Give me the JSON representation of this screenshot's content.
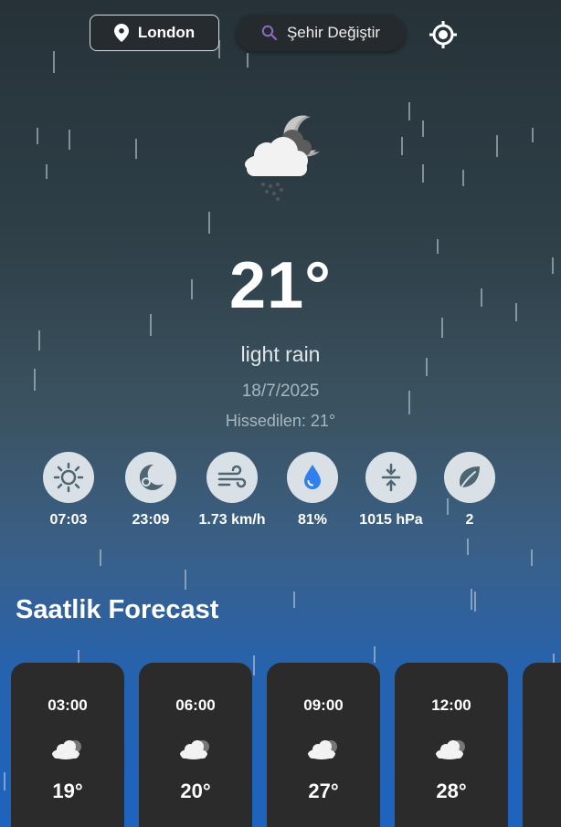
{
  "header": {
    "city": "London",
    "search_label": "Şehir Değiştir"
  },
  "current": {
    "temperature": "21°",
    "description": "light rain",
    "date": "18/7/2025",
    "feels_like": "Hissedilen: 21°"
  },
  "stats": [
    {
      "icon": "sunrise-icon",
      "value": "07:03"
    },
    {
      "icon": "moon-icon",
      "value": "23:09"
    },
    {
      "icon": "wind-icon",
      "value": "1.73 km/h"
    },
    {
      "icon": "humidity-icon",
      "value": "81%"
    },
    {
      "icon": "pressure-icon",
      "value": "1015 hPa"
    },
    {
      "icon": "leaf-icon",
      "value": "2"
    }
  ],
  "hourly": {
    "title": "Saatlik Forecast",
    "items": [
      {
        "time": "03:00",
        "icon": "cloud-icon",
        "temp": "19°"
      },
      {
        "time": "06:00",
        "icon": "cloud-icon",
        "temp": "20°"
      },
      {
        "time": "09:00",
        "icon": "cloud-icon",
        "temp": "27°"
      },
      {
        "time": "12:00",
        "icon": "cloud-icon",
        "temp": "28°"
      }
    ]
  },
  "colors": {
    "card_bg": "#2b2b2b",
    "stat_circle": "#d9e0e6",
    "accent_blue": "#1e63bf"
  }
}
